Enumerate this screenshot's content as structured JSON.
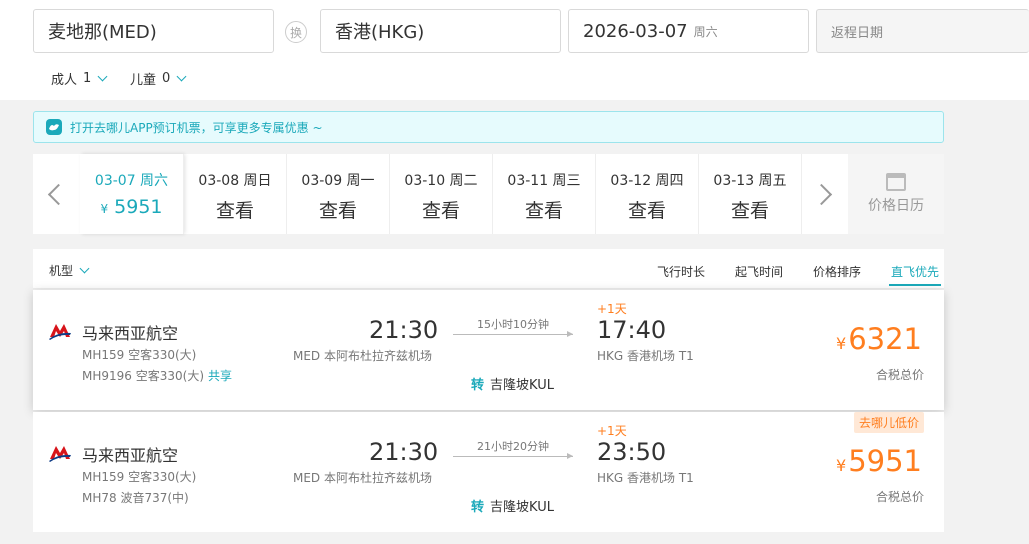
{
  "search": {
    "origin": "麦地那(MED)",
    "swap_label": "换",
    "destination": "香港(HKG)",
    "depart_date": "2026-03-07",
    "depart_weekday": "周六",
    "return_placeholder": "返程日期",
    "adult_label": "成人",
    "adult_count": "1",
    "child_label": "儿童",
    "child_count": "0"
  },
  "notice": {
    "text": "打开去哪儿APP预订机票，可享更多专属优惠 ~"
  },
  "dates": [
    {
      "date": "03-07 周六",
      "currency": "¥",
      "value": "5951"
    },
    {
      "date": "03-08 周日",
      "value": "查看"
    },
    {
      "date": "03-09 周一",
      "value": "查看"
    },
    {
      "date": "03-10 周二",
      "value": "查看"
    },
    {
      "date": "03-11 周三",
      "value": "查看"
    },
    {
      "date": "03-12 周四",
      "value": "查看"
    },
    {
      "date": "03-13 周五",
      "value": "查看"
    }
  ],
  "calendar_label": "价格日历",
  "sort": {
    "type_label": "机型",
    "options": [
      "飞行时长",
      "起飞时间",
      "价格排序",
      "直飞优先"
    ]
  },
  "flights": [
    {
      "airline": "马来西亚航空",
      "fn1": "MH159 空客330(大)",
      "fn2": "MH9196 空客330(大)",
      "share": "共享",
      "dep_time": "21:30",
      "dep_airport": "MED 本阿布杜拉齐兹机场",
      "duration": "15小时10分钟",
      "transfer_tag": "转",
      "transfer_city": "吉隆坡KUL",
      "plus_day": "+1天",
      "arr_time": "17:40",
      "arr_airport": "HKG 香港机场 T1",
      "currency": "¥",
      "price": "6321",
      "tax_label": "合税总价"
    },
    {
      "airline": "马来西亚航空",
      "fn1": "MH159 空客330(大)",
      "fn2": "MH78 波音737(中)",
      "badge": "去哪儿低价",
      "dep_time": "21:30",
      "dep_airport": "MED 本阿布杜拉齐兹机场",
      "duration": "21小时20分钟",
      "transfer_tag": "转",
      "transfer_city": "吉隆坡KUL",
      "plus_day": "+1天",
      "arr_time": "23:50",
      "arr_airport": "HKG 香港机场 T1",
      "currency": "¥",
      "price": "5951",
      "tax_label": "合税总价"
    }
  ],
  "colors": {
    "accent": "#1ba9ba",
    "price": "#ff7e1f"
  }
}
